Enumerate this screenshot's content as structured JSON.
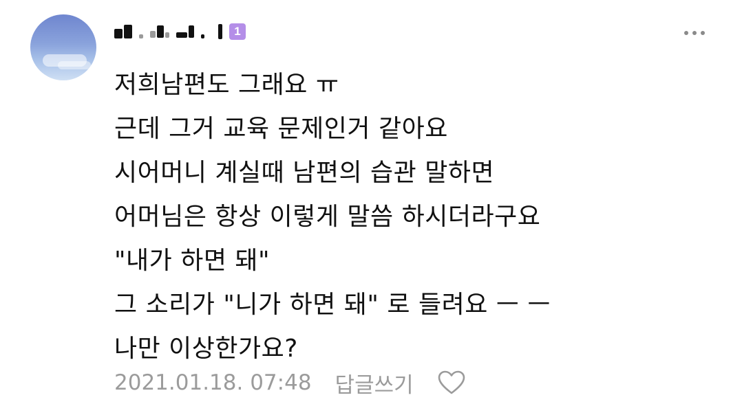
{
  "comment": {
    "author_badge": "1",
    "lines": [
      "저희남편도 그래요 ㅠ",
      "근데 그거 교육 문제인거 같아요",
      "시어머니 계실때 남편의 습관 말하면",
      "어머님은 항상 이렇게 말씀 하시더라구요",
      "\"내가 하면 돼\"",
      "그 소리가 \"니가 하면 돼\" 로 들려요 ㅡ ㅡ",
      "나만 이상한가요?"
    ],
    "timestamp": "2021.01.18. 07:48",
    "reply_label": "답글쓰기"
  },
  "icons": {
    "more": "more-horizontal-icon",
    "like": "heart-outline-icon"
  },
  "colors": {
    "badge": "#b48ee8",
    "meta_text": "#9b9b9b",
    "body_text": "#111111"
  }
}
